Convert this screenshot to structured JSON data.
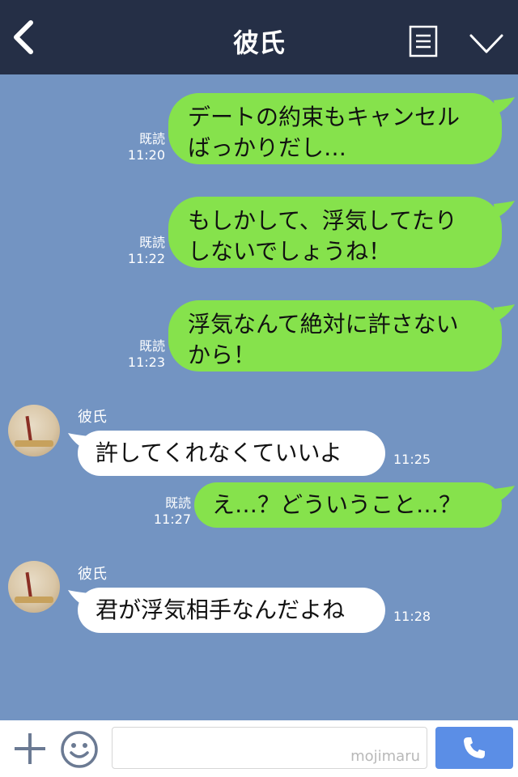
{
  "header": {
    "title": "彼氏"
  },
  "messages": [
    {
      "line1": "デートの約束もキャンセル",
      "line2": "ばっかりだし…",
      "read": "既読",
      "time": "11:20"
    },
    {
      "line1": "もしかして、浮気してたり",
      "line2": "しないでしょうね！",
      "read": "既読",
      "time": "11:22"
    },
    {
      "line1": "浮気なんて絶対に許さない",
      "line2": "から！",
      "read": "既読",
      "time": "11:23"
    },
    {
      "sender": "彼氏",
      "text": "許してくれなくていいよ",
      "time": "11:25"
    },
    {
      "text": "え…？どういうこと…？",
      "read": "既読",
      "time": "11:27"
    },
    {
      "sender": "彼氏",
      "text": "君が浮気相手なんだよね",
      "time": "11:28"
    }
  ],
  "footer": {
    "watermark": "mojimaru"
  },
  "colors": {
    "header_bg": "#252f46",
    "chat_bg": "#7394c2",
    "green_bubble": "#86e24c",
    "call_button": "#5b8ee6"
  }
}
